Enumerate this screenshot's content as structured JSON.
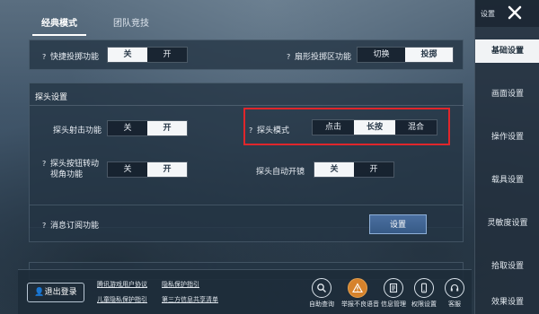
{
  "top_tabs": [
    "经典模式",
    "团队竞技"
  ],
  "rows": {
    "quick_throw": {
      "label": "快捷投掷功能",
      "options": [
        "关",
        "开"
      ],
      "selected": 0
    },
    "fan_throw": {
      "label": "扇形投掷区功能",
      "options": [
        "切换",
        "投掷"
      ],
      "selected": 1
    },
    "peek_section_title": "探头设置",
    "peek_fire": {
      "label": "探头射击功能",
      "options": [
        "关",
        "开"
      ],
      "selected": 1
    },
    "peek_mode": {
      "label": "探头模式",
      "options": [
        "点击",
        "长按",
        "混合"
      ],
      "selected": 1
    },
    "peek_rotate": {
      "label_line1": "探头按钮转动",
      "label_line2": "视角功能",
      "options": [
        "关",
        "开"
      ],
      "selected": 1
    },
    "peek_auto_scope": {
      "label": "探头自动开镜",
      "options": [
        "关",
        "开"
      ],
      "selected": 0
    },
    "msg_sub": {
      "label": "消息订阅功能",
      "button": "设置"
    }
  },
  "sidebar": {
    "header_label": "设置",
    "items": [
      "基础设置",
      "画面设置",
      "操作设置",
      "载具设置",
      "灵敏度设置",
      "拾取设置",
      "效果设置"
    ],
    "active_index": 0
  },
  "bottom": {
    "logout": "退出登录",
    "links": [
      "腾讯游戏用户协议",
      "隐私保护指引",
      "儿童隐私保护指引",
      "第三方信息共享清单"
    ],
    "icon_buttons": [
      {
        "label": "自助查询",
        "icon": "magnifier-icon"
      },
      {
        "label": "举报不良语音",
        "icon": "warning-icon"
      },
      {
        "label": "信息管理",
        "icon": "document-icon"
      },
      {
        "label": "权限设置",
        "icon": "mobile-icon"
      },
      {
        "label": "客服",
        "icon": "headset-icon"
      }
    ]
  },
  "colors": {
    "highlight": "#e0262b",
    "selected_option": "#f4f6f8",
    "button_blue": "#375a86"
  }
}
